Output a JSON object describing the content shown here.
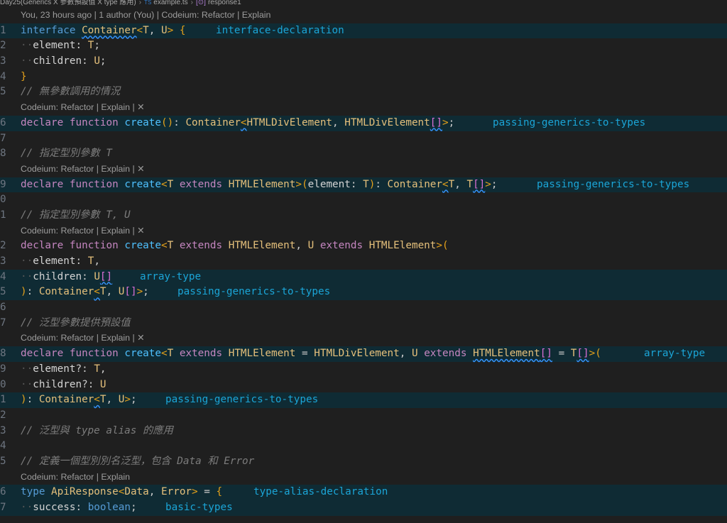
{
  "breadcrumb": {
    "folder": "Day25(Generics X 參數預設值 X type 應用)",
    "file": "example.ts",
    "symbol": "response1"
  },
  "blame": "You, 23 hours ago | 1 author (You) | Codeium: Refactor | Explain",
  "codelens": {
    "refactor_explain_close": "Codeium: Refactor | Explain | ✕",
    "refactor_explain": "Codeium: Refactor | Explain"
  },
  "annotations": {
    "a1": "interface-declaration",
    "a6": "passing-generics-to-types",
    "a9": "passing-generics-to-types",
    "a14": "array-type",
    "a15": "passing-generics-to-types",
    "a18": "array-type",
    "a21": "passing-generics-to-types",
    "a26": "type-alias-declaration",
    "a27": "basic-types"
  },
  "lines": {
    "n1": "1",
    "n2": "2",
    "n3": "3",
    "n4": "4",
    "n5": "5",
    "n6": "6",
    "n7": "7",
    "n8": "8",
    "n9": "9",
    "n10": "0",
    "n11": "1",
    "n12": "2",
    "n13": "3",
    "n14": "4",
    "n15": "5",
    "n16": "6",
    "n17": "7",
    "n18": "8",
    "n19": "9",
    "n20": "0",
    "n21": "1",
    "n22": "2",
    "n23": "3",
    "n24": "4",
    "n25": "5",
    "n26": "6",
    "n27": "7"
  },
  "comments": {
    "c5": "// 無參數調用的情況",
    "c8": "// 指定型別參數 T",
    "c11": "// 指定型別參數 T, U",
    "c17": "// 泛型參數提供預設值",
    "c23": "// 泛型與 type alias 的應用",
    "c25": "// 定義一個型別別名泛型，包含 Data 和 Error"
  },
  "colors": {
    "background": "#1f1f1f",
    "highlight": "#0f2b34",
    "keyword": "#569cd6",
    "declare": "#c586c0",
    "function_name": "#4fc1ff",
    "type": "#e5c07b",
    "annotation": "#1ba5d7",
    "squiggle": "#3794ff"
  }
}
